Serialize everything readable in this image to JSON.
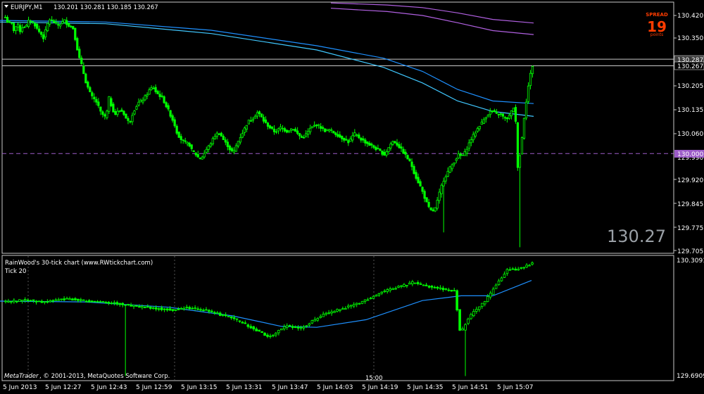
{
  "main": {
    "header_symbol": "EURJPY,M1",
    "header_ohlc": "130.201 130.281 130.185 130.267",
    "bid_big": "130.27",
    "spread": {
      "label": "SPREAD",
      "value": "19",
      "unit": "points"
    },
    "price_axis_labels": [
      "130.420",
      "130.350",
      "130.287",
      "130.267",
      "130.205",
      "130.135",
      "130.060",
      "130.000",
      "129.990",
      "129.920",
      "129.845",
      "129.775",
      "129.705"
    ]
  },
  "sub": {
    "title": "RainWood's 30-tick chart  (www.RWtickchart.com)",
    "subtitle": "Tick 20",
    "axis_labels": [
      "130.3091",
      "129.6909"
    ],
    "watermark_1": "MetaTrader",
    "watermark_2": ", © 2001-2013, MetaQuotes Software Corp.",
    "time_label": "15:00"
  },
  "time_axis": [
    "5 Jun 2013",
    "5 Jun 12:27",
    "5 Jun 12:43",
    "5 Jun 12:59",
    "5 Jun 13:15",
    "5 Jun 13:31",
    "5 Jun 13:47",
    "5 Jun 14:03",
    "5 Jun 14:19",
    "5 Jun 14:35",
    "5 Jun 14:51",
    "5 Jun 15:07"
  ],
  "colors": {
    "background": "#000000",
    "candle": "#00ff00",
    "ma_blue": "#1e90ff",
    "ma_cyan": "#40c8ff",
    "ma_violet": "#b060e0",
    "level_line": "#9c5cc8",
    "spread_text": "#ff3c00"
  },
  "chart_data": [
    {
      "type": "candlestick",
      "symbol": "EURJPY",
      "timeframe": "M1",
      "title": "EURJPY,M1",
      "ylim": [
        129.705,
        130.455
      ],
      "y_ticks": [
        130.42,
        130.35,
        130.205,
        130.135,
        130.06,
        129.99,
        129.92,
        129.845,
        129.775,
        129.705
      ],
      "last_ohlc": {
        "open": 130.201,
        "high": 130.281,
        "low": 130.185,
        "close": 130.267
      },
      "ask_line": 130.287,
      "bid_line": 130.267,
      "horizontal_level": 130.0,
      "close_path": [
        130.415,
        130.395,
        130.4,
        130.372,
        130.397,
        130.373,
        130.388,
        130.385,
        130.405,
        130.402,
        130.391,
        130.375,
        130.365,
        130.35,
        130.39,
        130.408,
        130.402,
        130.396,
        130.39,
        130.398,
        130.405,
        130.393,
        130.386,
        130.38,
        130.33,
        130.29,
        130.262,
        130.222,
        130.198,
        130.175,
        130.165,
        130.154,
        130.128,
        130.117,
        130.108,
        130.17,
        130.14,
        130.118,
        130.128,
        130.132,
        130.122,
        130.102,
        130.094,
        130.123,
        130.14,
        130.155,
        130.16,
        130.17,
        130.183,
        130.198,
        130.2,
        130.185,
        130.177,
        130.17,
        130.15,
        130.132,
        130.112,
        130.092,
        130.062,
        130.047,
        130.037,
        130.031,
        130.03,
        130.009,
        130.001,
        129.989,
        129.984,
        129.998,
        130.014,
        130.026,
        130.042,
        130.058,
        130.063,
        130.052,
        130.036,
        130.025,
        130.01,
        130.003,
        130.025,
        130.045,
        130.062,
        130.08,
        130.098,
        130.103,
        130.112,
        130.125,
        130.118,
        130.102,
        130.091,
        130.082,
        130.073,
        130.066,
        130.071,
        130.08,
        130.074,
        130.067,
        130.073,
        130.078,
        130.066,
        130.057,
        130.048,
        130.052,
        130.064,
        130.076,
        130.083,
        130.088,
        130.084,
        130.075,
        130.069,
        130.072,
        130.07,
        130.062,
        130.058,
        130.05,
        130.046,
        130.04,
        130.034,
        130.05,
        130.06,
        130.052,
        130.044,
        130.038,
        130.032,
        130.026,
        130.022,
        130.015,
        130.01,
        130.003,
        129.996,
        130.012,
        130.028,
        130.038,
        130.03,
        130.02,
        130.008,
        129.996,
        129.982,
        129.968,
        129.942,
        129.92,
        129.902,
        129.88,
        129.855,
        129.834,
        129.823,
        129.83,
        129.86,
        129.895,
        129.92,
        129.938,
        129.955,
        129.968,
        129.982,
        129.996,
        129.992,
        130.0,
        130.02,
        130.04,
        130.055,
        130.069,
        130.085,
        130.095,
        130.11,
        130.12,
        130.13,
        130.125,
        130.118,
        130.122,
        130.112,
        130.104,
        130.112,
        130.13,
        130.148,
        129.96,
        130.01,
        130.1,
        130.17,
        130.232,
        130.267
      ],
      "series": [
        {
          "name": "",
          "kind": "moving_average",
          "color": "#1e90ff",
          "x": [
            0,
            150,
            300,
            450,
            545,
            600,
            650,
            700,
            758
          ],
          "y": [
            130.405,
            130.4,
            130.375,
            130.328,
            130.29,
            130.25,
            130.195,
            130.16,
            130.152
          ]
        },
        {
          "name": "",
          "kind": "moving_average",
          "color": "#40c8ff",
          "x": [
            0,
            150,
            300,
            450,
            545,
            600,
            650,
            700,
            758
          ],
          "y": [
            130.4,
            130.395,
            130.365,
            130.315,
            130.262,
            130.215,
            130.16,
            130.128,
            130.113
          ]
        },
        {
          "name": "",
          "kind": "moving_average",
          "color": "#b060e0",
          "x": [
            470,
            550,
            600,
            650,
            700,
            758
          ],
          "y": [
            130.458,
            130.452,
            130.444,
            130.428,
            130.408,
            130.397
          ]
        },
        {
          "name": "",
          "kind": "moving_average",
          "color": "#b060e0",
          "x": [
            470,
            550,
            600,
            650,
            700,
            758
          ],
          "y": [
            130.442,
            130.432,
            130.42,
            130.398,
            130.374,
            130.362
          ]
        }
      ]
    },
    {
      "type": "bar",
      "title": "RainWood's 30-tick chart  (www.RWtickchart.com)",
      "subtitle": "Tick 20",
      "ylim": [
        129.6909,
        130.3091
      ],
      "y_ticks": [
        130.3091,
        129.6909
      ],
      "close_path": [
        130.09,
        130.092,
        130.094,
        130.098,
        130.096,
        130.092,
        130.088,
        130.09,
        130.095,
        130.1,
        130.104,
        130.102,
        130.098,
        130.094,
        130.092,
        130.09,
        130.088,
        130.086,
        130.082,
        130.078,
        130.072,
        130.068,
        130.064,
        130.06,
        130.058,
        130.055,
        130.052,
        130.048,
        130.045,
        130.052,
        130.055,
        130.058,
        130.052,
        130.046,
        130.04,
        130.03,
        130.02,
        130.012,
        130.0,
        129.988,
        129.972,
        129.955,
        129.938,
        129.92,
        129.905,
        129.925,
        129.948,
        129.962,
        129.958,
        129.948,
        129.962,
        129.982,
        130.0,
        130.018,
        130.03,
        130.04,
        130.05,
        130.06,
        130.07,
        130.082,
        130.095,
        130.11,
        130.125,
        130.14,
        130.15,
        130.16,
        130.17,
        130.178,
        130.19,
        130.182,
        130.172,
        130.168,
        130.16,
        130.155,
        130.15,
        130.145,
        129.92,
        129.985,
        130.03,
        130.06,
        130.09,
        130.13,
        130.18,
        130.22,
        130.262,
        130.255,
        130.265,
        130.275,
        130.29
      ],
      "series": [
        {
          "name": "",
          "kind": "moving_average",
          "color": "#1e90ff",
          "x": [
            0,
            120,
            240,
            330,
            400,
            450,
            520,
            600,
            655,
            700,
            755
          ],
          "y": [
            130.092,
            130.088,
            130.06,
            130.015,
            129.96,
            129.955,
            129.995,
            130.095,
            130.12,
            130.12,
            130.2
          ]
        }
      ]
    }
  ]
}
